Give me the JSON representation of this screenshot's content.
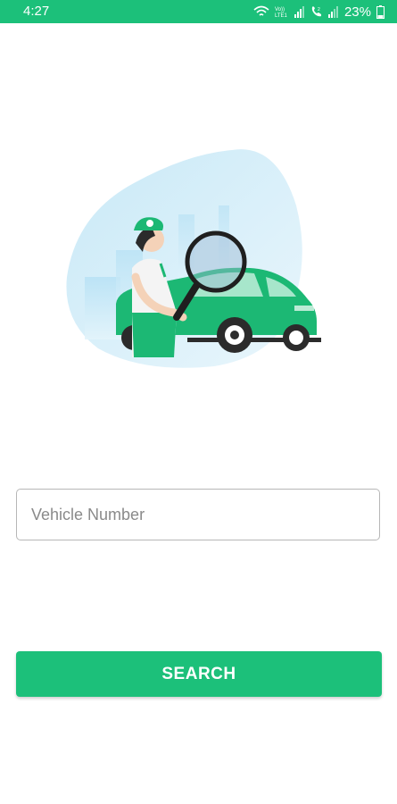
{
  "status_bar": {
    "time": "4:27",
    "battery": "23%",
    "icons": [
      "wifi-icon",
      "volte-lte1-icon",
      "signal-icon",
      "volte-call-icon",
      "signal-icon-2",
      "battery-icon"
    ]
  },
  "illustration": {
    "icon": "vehicle-search-illustration"
  },
  "search_form": {
    "vehicle_placeholder": "Vehicle Number",
    "vehicle_value": "",
    "search_label": "SEARCH"
  },
  "colors": {
    "brand": "#1cc07a",
    "field_border": "#b7b7b7",
    "placeholder": "#8a8a8a"
  }
}
